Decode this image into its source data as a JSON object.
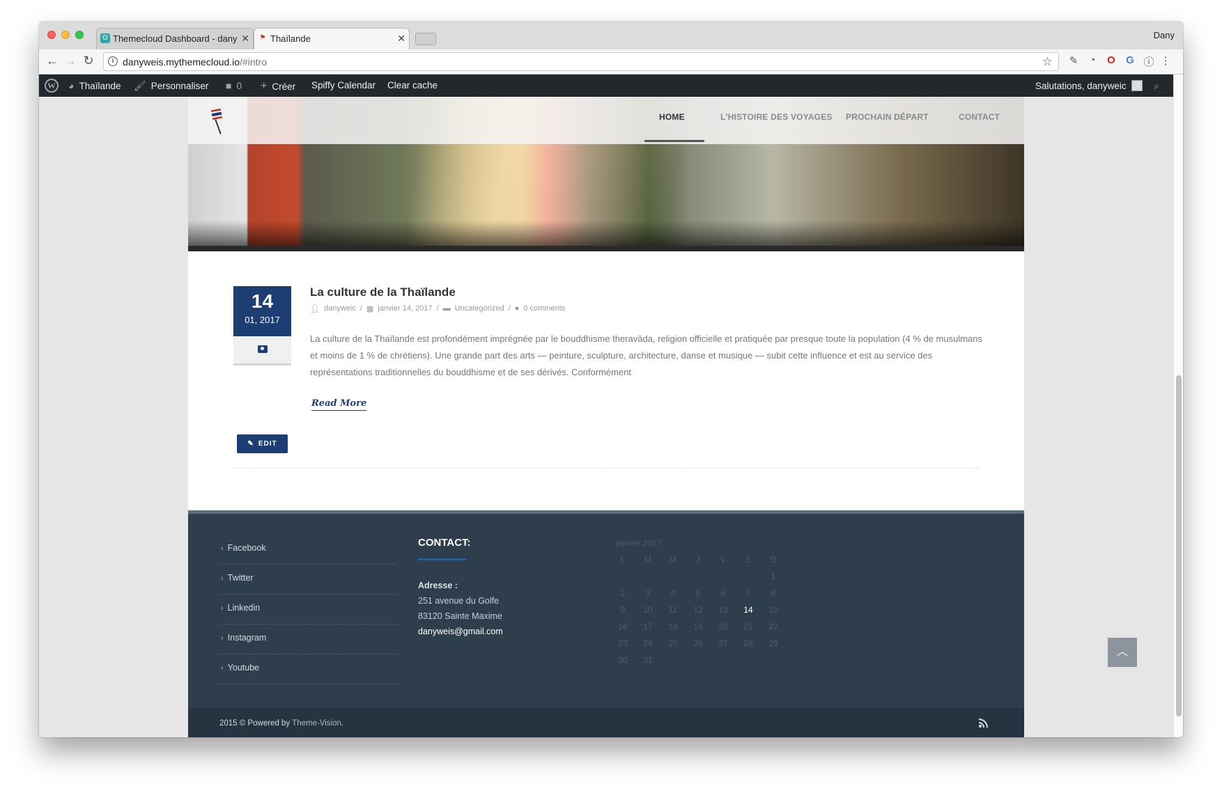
{
  "browser": {
    "tabs": [
      {
        "label": "Themecloud Dashboard - dany"
      },
      {
        "label": "Thaïlande"
      }
    ],
    "profile_name": "Dany",
    "url_host": "danyweis.mythemecloud.io",
    "url_path": "/#intro"
  },
  "admin_bar": {
    "site_name": "Thaïlande",
    "customize": "Personnaliser",
    "comments_count": "0",
    "create": "Créer",
    "calendar": "Spiffy Calendar",
    "clear_cache": "Clear cache",
    "greeting": "Salutations, danyweic"
  },
  "nav": {
    "items": [
      {
        "label": "HOME"
      },
      {
        "label": "L'HISTOIRE DES VOYAGES"
      },
      {
        "label": "PROCHAIN DÉPART"
      },
      {
        "label": "CONTACT"
      }
    ]
  },
  "post": {
    "day": "14",
    "month_year": "01, 2017",
    "title": "La culture de la Thaïlande",
    "author": "danyweic",
    "date": "janvier 14, 2017",
    "category": "Uncategorized",
    "comments": "0 comments",
    "excerpt": "La culture de la Thaïlande est profondément imprégnée par le bouddhisme theravāda, religion officielle et pratiquée par presque toute la population (4 % de musulmans et moins de 1 % de chrétiens). Une grande part des arts — peinture, sculpture, architecture, danse et musique — subit cette influence et est au service des représentations traditionnelles du bouddhisme et de ses dérivés. Conformément",
    "read_more": "Read More",
    "edit": "EDIT"
  },
  "footer": {
    "social": [
      {
        "label": "Facebook"
      },
      {
        "label": "Twitter"
      },
      {
        "label": "Linkedin"
      },
      {
        "label": "Instagram"
      },
      {
        "label": "Youtube"
      }
    ],
    "contact_title": "CONTACT:",
    "address_label": "Adresse :",
    "address_line1": "251 avenue du Golfe",
    "address_line2": "83120 Sainte Maxime",
    "email": "danyweis@gmail.com",
    "calendar": {
      "caption": "janvier 2017",
      "weekdays": [
        "L",
        "M",
        "M",
        "J",
        "V",
        "S",
        "D"
      ],
      "weeks": [
        [
          "",
          "",
          "",
          "",
          "",
          "",
          "1"
        ],
        [
          "2",
          "3",
          "4",
          "5",
          "6",
          "7",
          "8"
        ],
        [
          "9",
          "10",
          "11",
          "12",
          "13",
          "14",
          "15"
        ],
        [
          "16",
          "17",
          "18",
          "19",
          "20",
          "21",
          "22"
        ],
        [
          "23",
          "24",
          "25",
          "26",
          "27",
          "28",
          "29"
        ],
        [
          "30",
          "31",
          "",
          "",
          "",
          "",
          ""
        ]
      ],
      "today": "14"
    },
    "copyright_prefix": "2015 © Powered by ",
    "copyright_link": "Theme-Vision",
    "copyright_suffix": "."
  },
  "colors": {
    "accent": "#1d3e73",
    "admin_bar": "#23282d",
    "footer": "#2f3e4d"
  },
  "icons": [
    "wordpress-icon",
    "dashboard-icon",
    "brush-icon",
    "comment-icon",
    "plus-icon",
    "search-icon",
    "user-icon",
    "calendar-icon",
    "folder-icon",
    "camera-icon",
    "edit-icon",
    "rss-icon",
    "chevron-up-icon"
  ]
}
